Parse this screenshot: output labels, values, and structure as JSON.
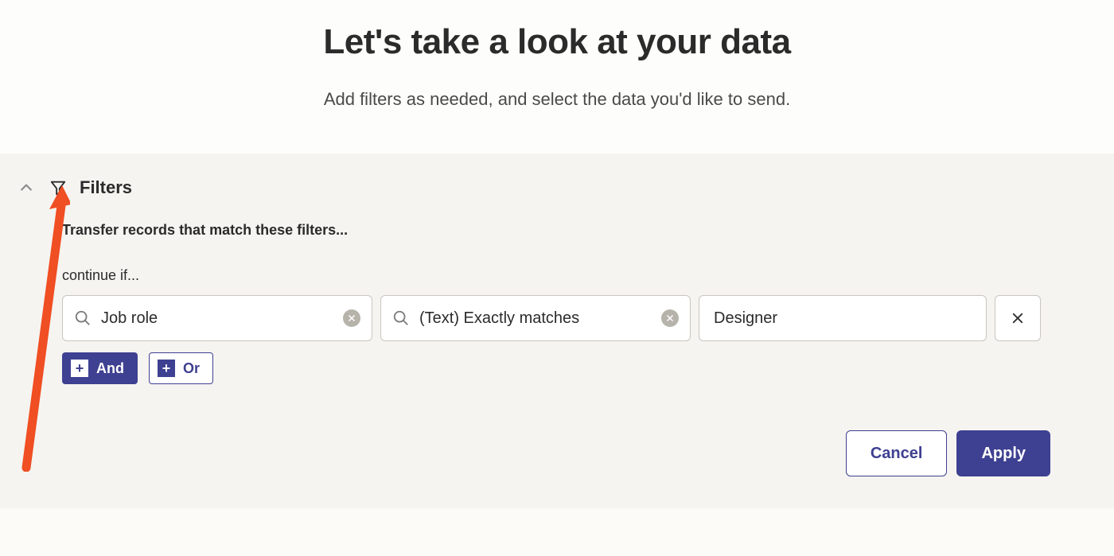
{
  "header": {
    "title": "Let's take a look at your data",
    "subtitle": "Add filters as needed, and select the data you'd like to send."
  },
  "filters": {
    "section_label": "Filters",
    "transfer_text": "Transfer records that match these filters...",
    "continue_text": "continue if...",
    "row": {
      "field": "Job role",
      "operator": "(Text) Exactly matches",
      "value": "Designer"
    },
    "logic": {
      "and_label": "And",
      "or_label": "Or"
    },
    "actions": {
      "cancel": "Cancel",
      "apply": "Apply"
    }
  }
}
